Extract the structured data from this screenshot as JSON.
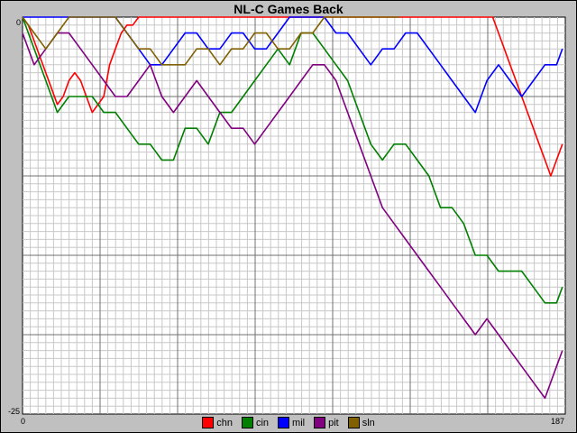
{
  "chart_data": {
    "type": "line",
    "title": "NL-C Games Back",
    "xlabel": "",
    "ylabel": "",
    "xlim": [
      0,
      187
    ],
    "ylim": [
      -25,
      0
    ],
    "x_ticks": [
      "0",
      "187"
    ],
    "y_ticks": [
      "0",
      "-25"
    ],
    "grid": true,
    "legend_position": "bottom-center",
    "series": [
      {
        "name": "chn",
        "color": "#ff0000",
        "x": [
          0,
          2,
          4,
          6,
          8,
          10,
          12,
          14,
          16,
          18,
          20,
          22,
          24,
          26,
          28,
          30,
          32,
          34,
          36,
          38,
          40,
          42,
          44,
          46,
          48,
          50,
          52,
          54,
          56,
          58,
          60,
          62,
          64,
          66,
          68,
          70,
          72,
          74,
          76,
          78,
          80,
          82,
          84,
          86,
          88,
          90,
          92,
          94,
          96,
          98,
          100,
          102,
          104,
          106,
          108,
          110,
          112,
          114,
          116,
          118,
          120,
          122,
          124,
          126,
          128,
          130,
          132,
          134,
          136,
          138,
          140,
          142,
          144,
          146,
          148,
          150,
          152,
          154,
          156,
          158,
          160,
          162,
          164,
          166,
          168,
          170,
          172,
          174,
          176,
          178,
          180,
          182,
          184,
          186
        ],
        "y": [
          0,
          -0.5,
          -1.5,
          -2.5,
          -3.5,
          -4.5,
          -5.5,
          -5,
          -4,
          -3.5,
          -4,
          -5,
          -6,
          -5.5,
          -5,
          -3,
          -2,
          -1,
          -0.5,
          -0.5,
          0,
          0,
          0,
          0,
          0,
          0,
          0,
          0,
          0,
          0,
          0,
          0,
          0,
          0,
          0,
          0,
          0,
          0,
          0,
          0,
          0,
          0,
          0,
          0,
          0,
          0,
          0,
          0,
          0,
          0,
          0,
          0,
          0,
          0,
          0,
          0,
          0,
          0,
          0,
          0,
          0,
          0,
          0,
          0,
          0,
          0,
          0,
          0,
          0,
          0,
          0,
          0,
          0,
          0,
          0,
          0,
          0,
          0,
          0,
          0,
          0,
          0,
          -1,
          -2,
          -3,
          -4,
          -5,
          -6,
          -7,
          -8,
          -9,
          -10,
          -9,
          -8
        ]
      },
      {
        "name": "cin",
        "color": "#008000",
        "x": [
          0,
          4,
          8,
          12,
          16,
          20,
          24,
          28,
          32,
          36,
          40,
          44,
          48,
          52,
          56,
          60,
          64,
          68,
          72,
          76,
          80,
          84,
          88,
          92,
          96,
          100,
          104,
          108,
          112,
          114,
          116,
          120,
          124,
          128,
          132,
          136,
          140,
          144,
          148,
          152,
          156,
          160,
          164,
          168,
          172,
          176,
          180,
          184,
          186
        ],
        "y": [
          0,
          -2,
          -4,
          -6,
          -5,
          -5,
          -5,
          -6,
          -6,
          -7,
          -8,
          -8,
          -9,
          -9,
          -7,
          -7,
          -8,
          -6,
          -6,
          -5,
          -4,
          -3,
          -2,
          -3,
          -1,
          -1,
          -2,
          -3,
          -4,
          -5,
          -6,
          -8,
          -9,
          -8,
          -8,
          -9,
          -10,
          -12,
          -12,
          -13,
          -15,
          -15,
          -16,
          -16,
          -16,
          -17,
          -18,
          -18,
          -17
        ]
      },
      {
        "name": "mil",
        "color": "#0000ff",
        "x": [
          0,
          4,
          8,
          12,
          16,
          20,
          24,
          28,
          32,
          36,
          40,
          44,
          48,
          52,
          56,
          60,
          64,
          68,
          72,
          76,
          80,
          84,
          88,
          92,
          96,
          100,
          104,
          108,
          112,
          116,
          120,
          124,
          128,
          132,
          136,
          140,
          144,
          148,
          152,
          156,
          160,
          164,
          168,
          172,
          176,
          180,
          184,
          186
        ],
        "y": [
          0,
          0,
          0,
          0,
          0,
          0,
          0,
          0,
          0,
          -1,
          -2,
          -3,
          -3,
          -2,
          -1,
          -1,
          -2,
          -2,
          -1,
          -1,
          -2,
          -2,
          -1,
          0,
          0,
          0,
          0,
          -1,
          -1,
          -2,
          -3,
          -2,
          -2,
          -1,
          -1,
          -2,
          -3,
          -4,
          -5,
          -6,
          -4,
          -3,
          -4,
          -5,
          -4,
          -3,
          -3,
          -2
        ]
      },
      {
        "name": "pit",
        "color": "#800080",
        "x": [
          0,
          4,
          8,
          12,
          16,
          20,
          24,
          28,
          32,
          36,
          40,
          44,
          48,
          52,
          56,
          60,
          64,
          68,
          72,
          76,
          80,
          84,
          88,
          92,
          96,
          100,
          104,
          108,
          112,
          116,
          120,
          124,
          128,
          132,
          136,
          140,
          144,
          148,
          152,
          156,
          160,
          164,
          168,
          172,
          176,
          180,
          184,
          186
        ],
        "y": [
          -1,
          -3,
          -2,
          -1,
          -1,
          -2,
          -3,
          -4,
          -5,
          -5,
          -4,
          -3,
          -5,
          -6,
          -5,
          -4,
          -5,
          -6,
          -7,
          -7,
          -8,
          -7,
          -6,
          -5,
          -4,
          -3,
          -3,
          -4,
          -6,
          -8,
          -10,
          -12,
          -13,
          -14,
          -15,
          -16,
          -17,
          -18,
          -19,
          -20,
          -19,
          -20,
          -21,
          -22,
          -23,
          -24,
          -22,
          -21
        ]
      },
      {
        "name": "sln",
        "color": "#806000",
        "x": [
          0,
          4,
          8,
          12,
          16,
          20,
          24,
          28,
          32,
          36,
          40,
          44,
          48,
          52,
          56,
          60,
          64,
          68,
          72,
          76,
          80,
          84,
          88,
          92,
          96,
          100,
          104,
          108,
          112,
          116,
          120,
          124,
          128,
          130
        ],
        "y": [
          0,
          -1,
          -2,
          -1,
          0,
          0,
          0,
          0,
          0,
          -1,
          -2,
          -2,
          -3,
          -3,
          -3,
          -2,
          -2,
          -3,
          -2,
          -2,
          -1,
          -1,
          -2,
          -2,
          -1,
          -1,
          0,
          0,
          0,
          0,
          0,
          0,
          0,
          0
        ]
      }
    ]
  }
}
